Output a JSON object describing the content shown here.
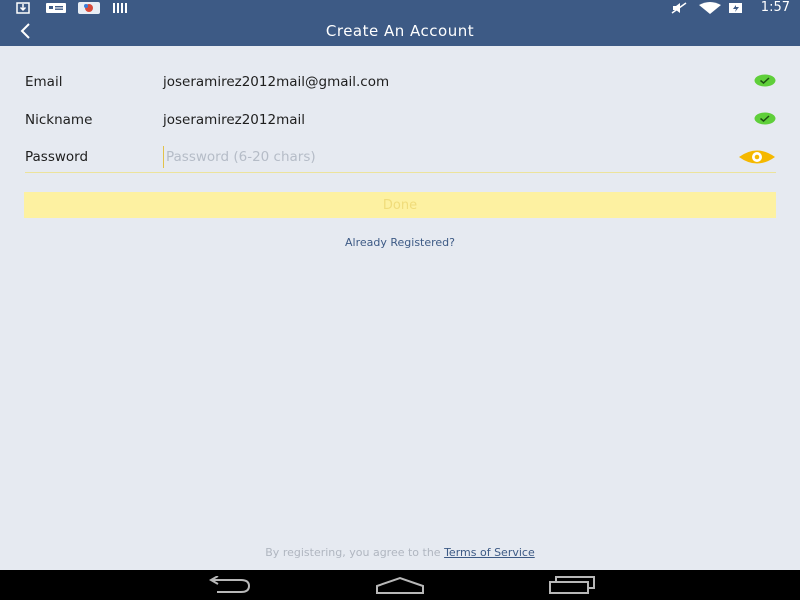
{
  "status_bar": {
    "time": "1:57",
    "left_icons": [
      "download-icon",
      "message-icon",
      "app-notification-icon",
      "barcode-icon"
    ],
    "right_icons": [
      "mute-icon",
      "wifi-icon",
      "battery-icon"
    ]
  },
  "app_bar": {
    "title": "Create An Account",
    "back_icon": "back-arrow-icon"
  },
  "form": {
    "email": {
      "label": "Email",
      "value": "joseramirez2012mail@gmail.com",
      "valid": true
    },
    "nickname": {
      "label": "Nickname",
      "value": "joseramirez2012mail",
      "valid": true
    },
    "password": {
      "label": "Password",
      "value": "",
      "placeholder": "Password (6-20 chars)",
      "toggle_icon": "eye-icon"
    }
  },
  "done_label": "Done",
  "already_registered": "Already Registered?",
  "terms": {
    "prefix": "By registering, you agree to the",
    "link": "Terms of Service"
  },
  "nav_bar": {
    "icons": [
      "back-nav-icon",
      "home-nav-icon",
      "recents-nav-icon"
    ]
  },
  "colors": {
    "primary": "#3d5a85",
    "background": "#e6eaf1",
    "valid_check": "#5fcf3a",
    "accent_yellow": "#fdf1a1",
    "eye_icon": "#f5b800"
  }
}
